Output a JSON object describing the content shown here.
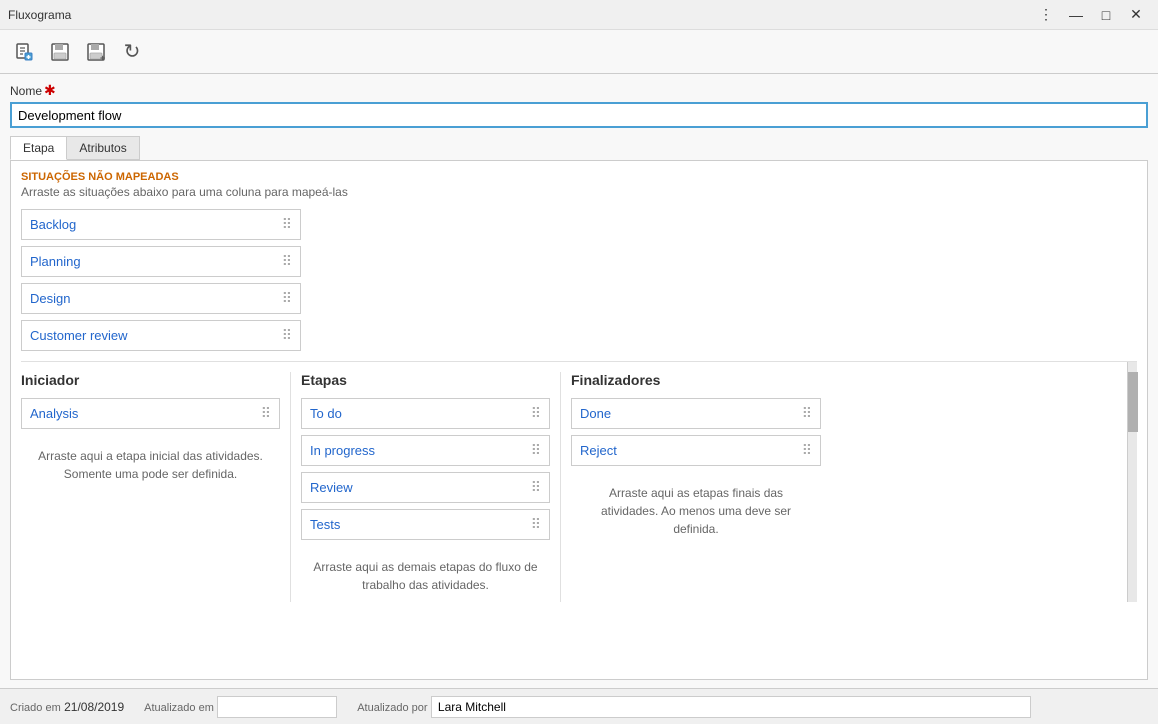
{
  "titlebar": {
    "title": "Fluxograma",
    "menu_icon": "⋮",
    "minimize": "—",
    "maximize": "☐",
    "close": "✕"
  },
  "toolbar": {
    "buttons": [
      {
        "name": "new-button",
        "icon": "🖨",
        "label": "New"
      },
      {
        "name": "save-button",
        "icon": "💾",
        "label": "Save"
      },
      {
        "name": "save-as-button",
        "icon": "💾",
        "label": "Save As"
      },
      {
        "name": "refresh-button",
        "icon": "↻",
        "label": "Refresh"
      }
    ]
  },
  "form": {
    "name_label": "Nome",
    "name_value": "Development flow"
  },
  "tabs": [
    {
      "id": "etapa",
      "label": "Etapa",
      "active": true
    },
    {
      "id": "atributos",
      "label": "Atributos",
      "active": false
    }
  ],
  "unmapped": {
    "label": "SITUAÇÕES NÃO MAPEADAS",
    "hint": "Arraste as situações abaixo para uma coluna para mapeá-las"
  },
  "columns": {
    "unmapped": {
      "items": [
        {
          "name": "Backlog"
        },
        {
          "name": "Planning"
        },
        {
          "name": "Design"
        },
        {
          "name": "Customer review"
        }
      ]
    },
    "iniciador": {
      "header": "Iniciador",
      "items": [
        {
          "name": "Analysis"
        }
      ],
      "hint": "Arraste aqui a etapa inicial das atividades. Somente uma pode ser definida."
    },
    "etapas": {
      "header": "Etapas",
      "items": [
        {
          "name": "To do"
        },
        {
          "name": "In progress"
        },
        {
          "name": "Review"
        },
        {
          "name": "Tests"
        }
      ],
      "hint": "Arraste aqui as demais etapas do fluxo de trabalho das atividades."
    },
    "finalizadores": {
      "header": "Finalizadores",
      "items": [
        {
          "name": "Done"
        },
        {
          "name": "Reject"
        }
      ],
      "hint": "Arraste aqui as etapas finais das atividades. Ao menos uma deve ser definida."
    }
  },
  "footer": {
    "created_label": "Criado em",
    "created_value": "21/08/2019",
    "updated_label": "Atualizado em",
    "updated_value": "",
    "updated_by_label": "Atualizado por",
    "updated_by_value": "Lara Mitchell"
  }
}
